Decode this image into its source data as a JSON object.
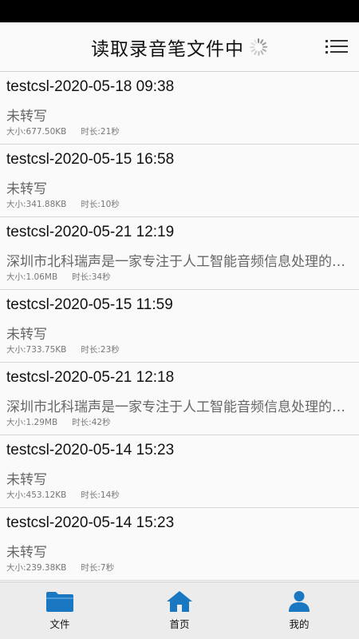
{
  "header": {
    "title": "读取录音笔文件中",
    "loading_icon": "spinner-icon",
    "menu_icon": "list-menu-icon"
  },
  "recordings": [
    {
      "title": "testcsl-2020-05-18 09:38",
      "summary": "未转写",
      "size": "大小:677.50KB",
      "duration": "时长:21秒"
    },
    {
      "title": "testcsl-2020-05-15 16:58",
      "summary": "未转写",
      "size": "大小:341.88KB",
      "duration": "时长:10秒"
    },
    {
      "title": "testcsl-2020-05-21 12:19",
      "summary": "深圳市北科瑞声是一家专注于人工智能音频信息处理的公司",
      "size": "大小:1.06MB",
      "duration": "时长:34秒"
    },
    {
      "title": "testcsl-2020-05-15 11:59",
      "summary": "未转写",
      "size": "大小:733.75KB",
      "duration": "时长:23秒"
    },
    {
      "title": "testcsl-2020-05-21 12:18",
      "summary": "深圳市北科瑞声是一家专注于人工智能音频信息处理的公司",
      "size": "大小:1.29MB",
      "duration": "时长:42秒"
    },
    {
      "title": "testcsl-2020-05-14 15:23",
      "summary": "未转写",
      "size": "大小:453.12KB",
      "duration": "时长:14秒"
    },
    {
      "title": "testcsl-2020-05-14 15:23",
      "summary": "未转写",
      "size": "大小:239.38KB",
      "duration": "时长:7秒"
    }
  ],
  "tabs": [
    {
      "label": "文件",
      "icon": "folder-icon"
    },
    {
      "label": "首页",
      "icon": "home-icon"
    },
    {
      "label": "我的",
      "icon": "user-icon"
    }
  ],
  "colors": {
    "accent": "#1a78c2",
    "status_bar": "#000000",
    "tabbar_bg": "#ececec"
  }
}
